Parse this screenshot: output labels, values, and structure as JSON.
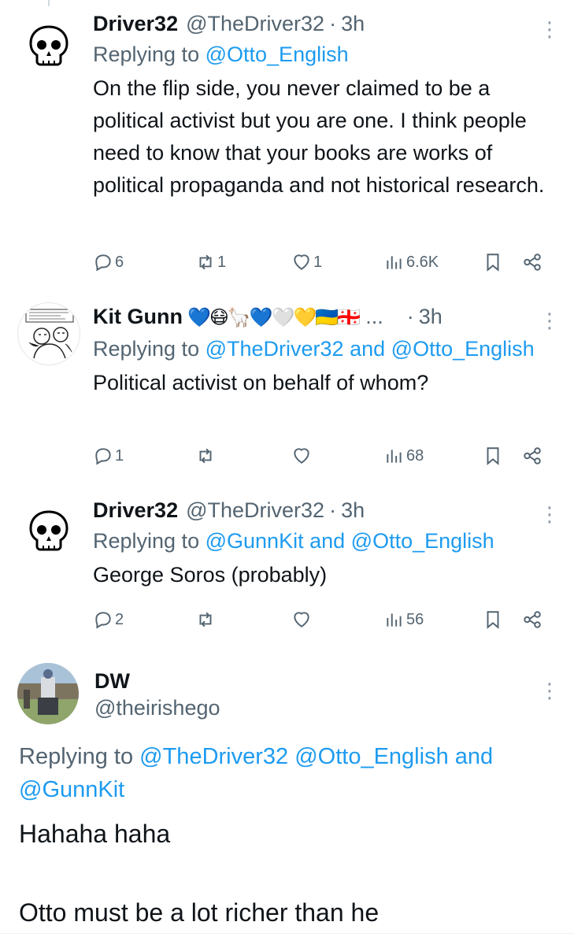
{
  "tweets": [
    {
      "name": "Driver32",
      "handle": "@TheDriver32",
      "time": "3h",
      "replying_prefix": "Replying to",
      "mentions": [
        "@Otto_English"
      ],
      "text": "On the flip side, you never claimed to be a political activist but you are one. I think people need to know that your books are works of political propaganda and not historical research.",
      "replies": "6",
      "reposts": "1",
      "likes": "1",
      "views": "6.6K"
    },
    {
      "name": "Kit Gunn",
      "emojis": "💙😷🦙💙🤍💛🇺🇦🇬🇪",
      "ellipsis": "...",
      "time": "3h",
      "replying_prefix": "Replying to",
      "mentions": [
        "@TheDriver32",
        "@Otto_English"
      ],
      "joiner": "and",
      "text": "Political activist on behalf of whom?",
      "replies": "1",
      "reposts": "",
      "likes": "",
      "views": "68"
    },
    {
      "name": "Driver32",
      "handle": "@TheDriver32",
      "time": "3h",
      "replying_prefix": "Replying to",
      "mentions": [
        "@GunnKit",
        "@Otto_English"
      ],
      "joiner": "and",
      "text": "George Soros (probably)",
      "replies": "2",
      "reposts": "",
      "likes": "",
      "views": "56"
    }
  ],
  "main_tweet": {
    "name": "DW",
    "handle": "@theirishego",
    "replying_prefix": "Replying to",
    "mentions": [
      "@TheDriver32",
      "@Otto_English",
      "@GunnKit"
    ],
    "joiner": "and",
    "text_line1": "Hahaha haha",
    "text_line2": "Otto must be a lot richer than he"
  },
  "icons": {
    "reply": "reply-bubble-icon",
    "repost": "repost-arrows-icon",
    "like": "heart-icon",
    "views": "views-bars-icon",
    "bookmark": "bookmark-icon",
    "share": "share-icon",
    "more": "more-vertical-icon"
  },
  "colors": {
    "link": "#1d9bf0",
    "secondary": "#536471",
    "primary": "#0f1419"
  }
}
